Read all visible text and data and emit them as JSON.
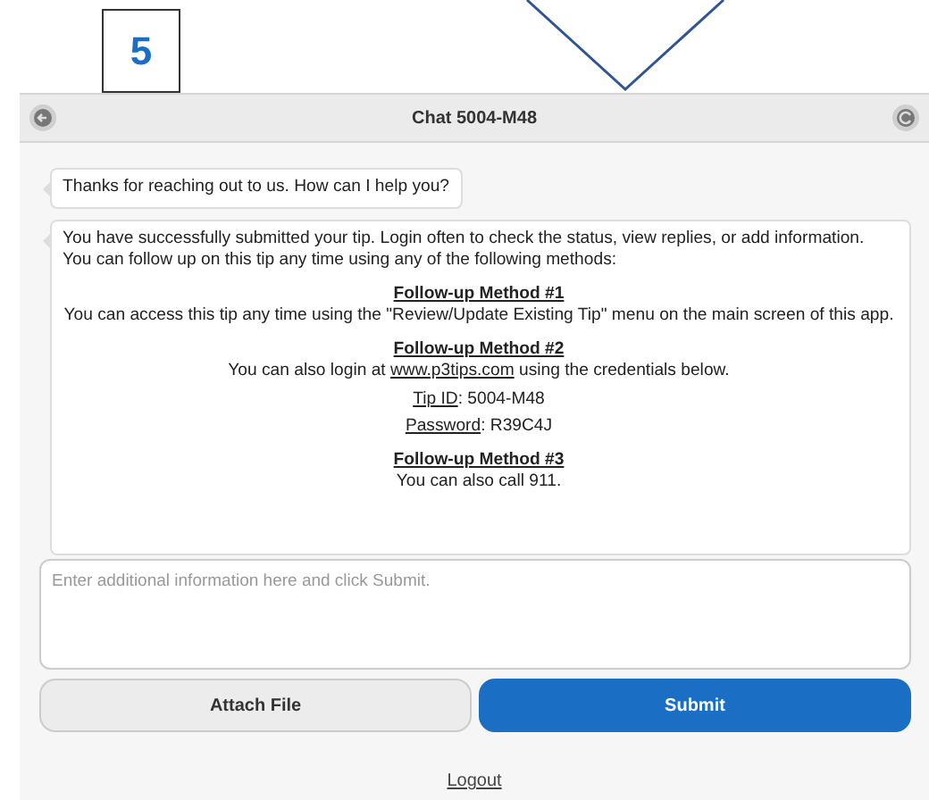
{
  "annotation": {
    "step": "5"
  },
  "header": {
    "title": "Chat 5004-M48"
  },
  "messages": [
    {
      "kind": "simple",
      "text": "Thanks for reaching out to us. How can I help you?"
    },
    {
      "kind": "detailed",
      "intro": "You have successfully submitted your tip. Login often to check the status, view replies, or add information. You can follow up on this tip any time using any of the following methods:",
      "sections": [
        {
          "heading": "Follow-up Method #1",
          "lines": [
            {
              "kind": "text",
              "text": "You can access this tip any time using the \"Review/Update Existing Tip\" menu on the main screen of this app."
            }
          ]
        },
        {
          "heading": "Follow-up Method #2",
          "lines": [
            {
              "kind": "link",
              "before": "You can also login at",
              "link": "www.p3tips.com",
              "after": "using the credentials below."
            },
            {
              "kind": "field",
              "label": "Tip ID",
              "value": ": 5004-M48"
            },
            {
              "kind": "field",
              "label": "Password",
              "value": ": R39C4J"
            }
          ]
        },
        {
          "heading": "Follow-up Method #3",
          "lines": [
            {
              "kind": "text",
              "text": "You can also call 911."
            }
          ]
        }
      ]
    }
  ],
  "input": {
    "placeholder": "Enter additional information here and click Submit."
  },
  "buttons": [
    {
      "kind": "secondary",
      "label": "Attach File"
    },
    {
      "kind": "primary",
      "label": "Submit"
    }
  ],
  "footer_link": "Logout"
}
